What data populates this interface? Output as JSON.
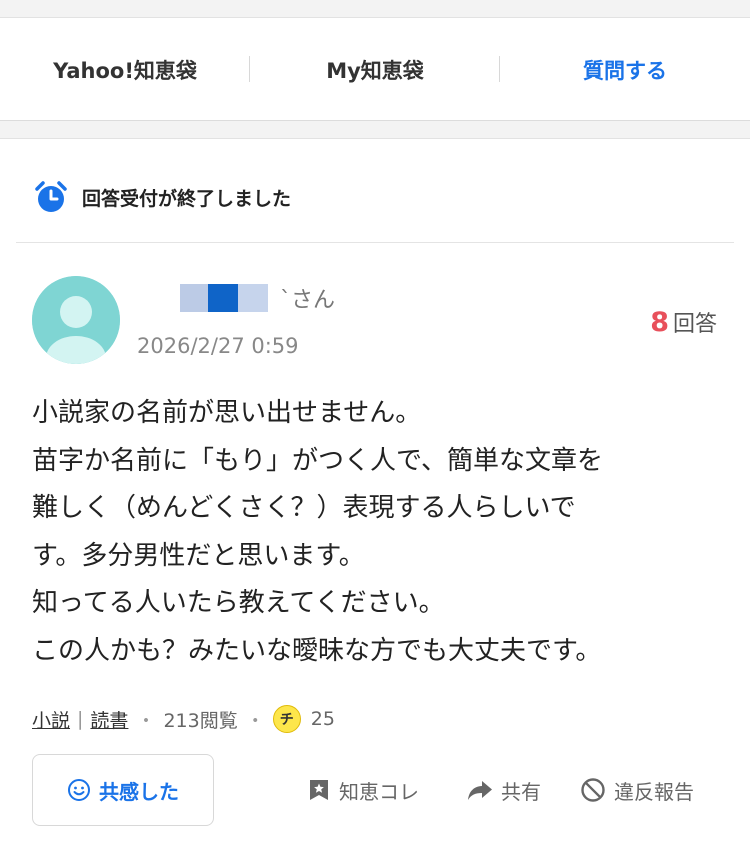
{
  "nav": {
    "items": [
      {
        "label": "Yahoo!知恵袋"
      },
      {
        "label": "My知恵袋"
      },
      {
        "label": "質問する"
      }
    ]
  },
  "status": {
    "closed_text": "回答受付が終了しました",
    "icon": "alarm-clock-icon"
  },
  "question": {
    "user_suffix": "`さん",
    "date": "2026/2/27 0:59",
    "answer_count": "8",
    "answer_label": "回答",
    "body_lines": [
      "小説家の名前が思い出せません。",
      "苗字か名前に「もり」がつく人で、簡単な文章を",
      "難しく（めんどくさく？）表現する人らしいで",
      "す。多分男性だと思います。",
      "知ってる人いたら教えてください。",
      "この人かも？みたいな曖昧な方でも大丈夫です。"
    ],
    "tags": [
      "小説",
      "読書"
    ],
    "tag_separator": "|",
    "views": "213閲覧",
    "coin_label": "チ",
    "coins": "25"
  },
  "actions": {
    "empathy_label": "共感した",
    "chiekore_label": "知恵コレ",
    "share_label": "共有",
    "report_label": "違反報告"
  },
  "colors": {
    "accent": "#1a73e8",
    "answer_count": "#e8505b",
    "avatar": "#7fd5d3"
  }
}
